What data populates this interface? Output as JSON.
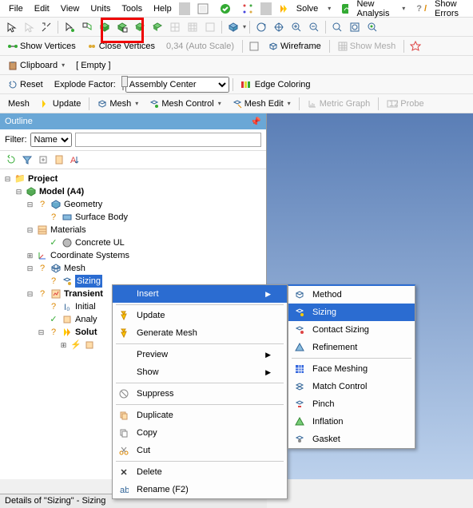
{
  "menu": {
    "file": "File",
    "edit": "Edit",
    "view": "View",
    "units": "Units",
    "tools": "Tools",
    "help": "Help"
  },
  "tb1": {
    "solve": "Solve",
    "new_analysis": "New Analysis",
    "show_errors": "Show Errors"
  },
  "tb3": {
    "show_vertices": "Show Vertices",
    "close_vertices": "Close Vertices",
    "autoscale": "0,34 (Auto Scale)",
    "wireframe": "Wireframe",
    "show_mesh": "Show Mesh"
  },
  "tb4": {
    "clipboard": "Clipboard",
    "empty": "[ Empty ]"
  },
  "tb5": {
    "reset": "Reset",
    "explode": "Explode Factor:",
    "assembly": "Assembly Center",
    "edge": "Edge Coloring"
  },
  "tb6": {
    "mesh": "Mesh",
    "update": "Update",
    "mesh2": "Mesh",
    "mesh_ctrl": "Mesh Control",
    "mesh_edit": "Mesh Edit",
    "metric": "Metric Graph",
    "probe": "Probe"
  },
  "outline": {
    "title": "Outline",
    "filter": "Filter:",
    "name_opt": "Name"
  },
  "tree": {
    "project": "Project",
    "model": "Model (A4)",
    "geometry": "Geometry",
    "surface": "Surface Body",
    "materials": "Materials",
    "concrete": "Concrete UL",
    "coord": "Coordinate Systems",
    "mesh": "Mesh",
    "sizing": "Sizing",
    "transient": "Transient",
    "initial": "Initial",
    "analy": "Analy",
    "solut": "Solut"
  },
  "ctx": {
    "insert": "Insert",
    "update": "Update",
    "generate": "Generate Mesh",
    "preview": "Preview",
    "show": "Show",
    "suppress": "Suppress",
    "duplicate": "Duplicate",
    "copy": "Copy",
    "cut": "Cut",
    "delete": "Delete",
    "rename": "Rename (F2)"
  },
  "sub": {
    "method": "Method",
    "sizing": "Sizing",
    "contact": "Contact Sizing",
    "refine": "Refinement",
    "face": "Face Meshing",
    "match": "Match Control",
    "pinch": "Pinch",
    "inflation": "Inflation",
    "gasket": "Gasket"
  },
  "details": "Details of \"Sizing\" - Sizing"
}
